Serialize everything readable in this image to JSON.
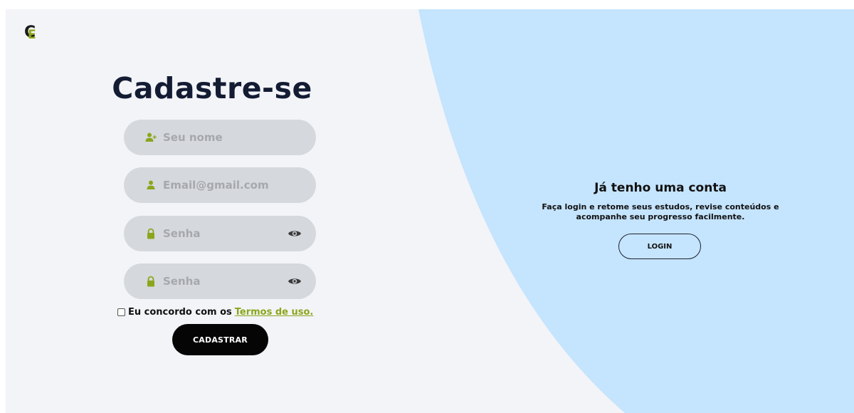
{
  "colors": {
    "background": "#f3f4f8",
    "accent_blue": "#c5e4fd",
    "accent_green": "#8aa61c",
    "field_bg": "#d5d8dc",
    "title": "#131c33",
    "button_dark": "#050505"
  },
  "logo": {
    "letter_c": "C",
    "letter_e": "E"
  },
  "signup": {
    "title": "Cadastre-se",
    "name_placeholder": "Seu nome",
    "email_placeholder": "Email@gmail.com",
    "password_placeholder": "Senha",
    "confirm_placeholder": "Senha",
    "name_icon": "user-plus-icon",
    "email_icon": "user-icon",
    "password_icon": "lock-icon",
    "reveal_icon": "eye-icon",
    "terms_text": "Eu concordo com os",
    "terms_link": "Termos de uso.",
    "submit_label": "CADASTRAR"
  },
  "login_panel": {
    "heading": "Já tenho uma conta",
    "description": "Faça login e retome seus estudos, revise conteúdos e acompanhe seu progresso facilmente.",
    "button_label": "LOGIN"
  }
}
